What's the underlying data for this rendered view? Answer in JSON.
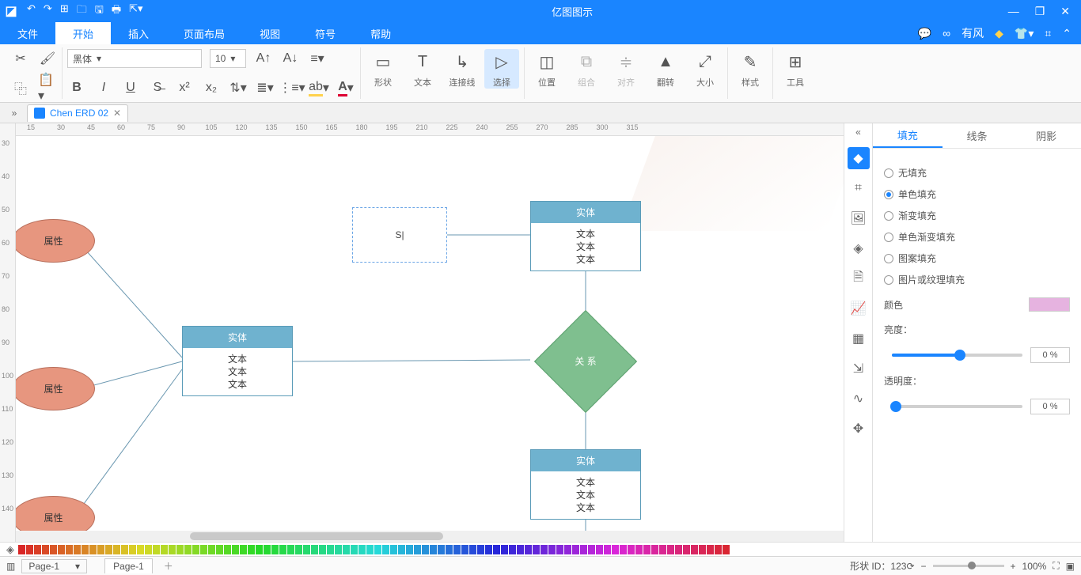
{
  "app_title": "亿图图示",
  "user_label": "有风",
  "menu": {
    "file": "文件",
    "start": "开始",
    "insert": "插入",
    "layout": "页面布局",
    "view": "视图",
    "symbol": "符号",
    "help": "帮助"
  },
  "font": {
    "name": "黑体",
    "size": "10"
  },
  "ribbon": {
    "shape": "形状",
    "text": "文本",
    "connector": "连接线",
    "select": "选择",
    "position": "位置",
    "group": "组合",
    "align": "对齐",
    "flip": "翻转",
    "size": "大小",
    "style": "样式",
    "tools": "工具"
  },
  "doc_tab": "Chen ERD 02",
  "ruler_h": [
    "15",
    "30",
    "45",
    "60",
    "75",
    "90",
    "105",
    "120",
    "135",
    "150",
    "165",
    "180",
    "195",
    "210",
    "225",
    "240",
    "255",
    "270",
    "285",
    "300",
    "315"
  ],
  "ruler_v": [
    "30",
    "40",
    "50",
    "60",
    "70",
    "80",
    "90",
    "100",
    "110",
    "120",
    "130",
    "140"
  ],
  "shapes": {
    "attr": "属性",
    "entity": "实体",
    "text": "文本",
    "relation": "关 系",
    "editing": "S|"
  },
  "panel": {
    "tabs": {
      "fill": "填充",
      "line": "线条",
      "shadow": "阴影"
    },
    "fill_none": "无填充",
    "fill_solid": "单色填充",
    "fill_gradient": "渐变填充",
    "fill_mono_gradient": "单色渐变填充",
    "fill_pattern": "图案填充",
    "fill_texture": "图片或纹理填充",
    "color": "颜色",
    "brightness": "亮度：",
    "opacity": "透明度：",
    "pct0": "0 %"
  },
  "status": {
    "page_sel": "Page-1",
    "page_tab": "Page-1",
    "shape_id": "形状 ID：123",
    "zoom": "100%"
  }
}
